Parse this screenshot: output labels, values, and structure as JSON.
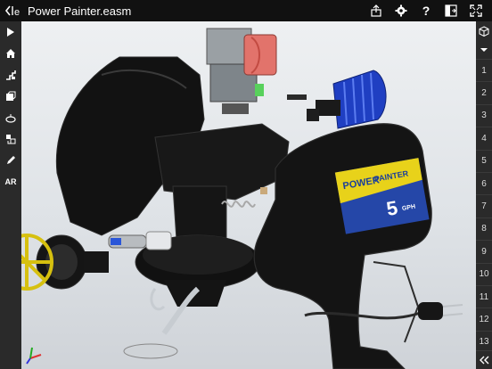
{
  "window": {
    "title": "Power Painter.easm",
    "brand": "e"
  },
  "toolbar_top": {
    "icons": [
      "share-icon",
      "gear-icon",
      "help-icon",
      "split-view-icon",
      "fullscreen-icon"
    ],
    "help_label": "?"
  },
  "toolbar_left": {
    "icons": [
      "play-icon",
      "home-icon",
      "views-icon",
      "section-icon",
      "measure-icon",
      "explode-icon",
      "markup-icon"
    ],
    "ar_label": "AR"
  },
  "toolbar_right": {
    "cube_icon": "cube-icon",
    "dropdown_icon": "chevron-down-icon",
    "config_numbers": [
      "1",
      "2",
      "3",
      "4",
      "5",
      "6",
      "7",
      "8",
      "9",
      "10",
      "11",
      "12",
      "13"
    ],
    "collapse_icon": "double-chevron-left-icon"
  },
  "model": {
    "label_line1": "POWER",
    "label_line2": "PAINTER",
    "label_number": "5",
    "label_unit": "GPH"
  },
  "colors": {
    "accent_yellow": "#e8d21a",
    "label_blue": "#1b3f9a",
    "motor_blue": "#1d3fc4",
    "coil_red": "#e0605a",
    "body_black": "#151515"
  }
}
